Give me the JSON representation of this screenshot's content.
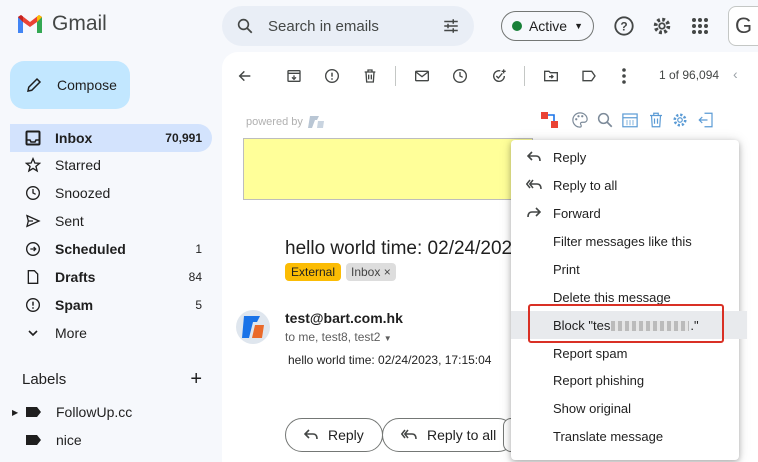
{
  "header": {
    "app_name": "Gmail",
    "search_placeholder": "Search in emails",
    "status_label": "Active",
    "account_initial": "G"
  },
  "sidebar": {
    "compose_label": "Compose",
    "items": [
      {
        "label": "Inbox",
        "count": "70,991",
        "icon": "inbox-icon"
      },
      {
        "label": "Starred",
        "count": "",
        "icon": "star-icon"
      },
      {
        "label": "Snoozed",
        "count": "",
        "icon": "clock-icon"
      },
      {
        "label": "Sent",
        "count": "",
        "icon": "send-icon"
      },
      {
        "label": "Scheduled",
        "count": "1",
        "icon": "scheduled-icon"
      },
      {
        "label": "Drafts",
        "count": "84",
        "icon": "draft-icon"
      },
      {
        "label": "Spam",
        "count": "5",
        "icon": "spam-icon"
      },
      {
        "label": "More",
        "count": "",
        "icon": "chevron-down-icon"
      }
    ],
    "labels_heading": "Labels",
    "labels": [
      {
        "label": "FollowUp.cc"
      },
      {
        "label": "nice"
      }
    ]
  },
  "toolbar": {
    "pager": "1 of 96,094"
  },
  "message": {
    "powered_by": "powered by",
    "subject": "hello world time: 02/24/2023, 17:15:04",
    "tag_external": "External",
    "tag_inbox": "Inbox",
    "sender": "test@bart.com.hk",
    "recipients": "to me, test8, test2",
    "body": "hello world time: 02/24/2023, 17:15:04",
    "reply_label": "Reply",
    "reply_all_label": "Reply to all"
  },
  "menu": {
    "items": [
      {
        "label": "Reply",
        "icon": "reply-icon"
      },
      {
        "label": "Reply to all",
        "icon": "reply-all-icon"
      },
      {
        "label": "Forward",
        "icon": "forward-icon"
      },
      {
        "label": "Filter messages like this",
        "icon": ""
      },
      {
        "label": "Print",
        "icon": ""
      },
      {
        "label": "Delete this message",
        "icon": ""
      },
      {
        "label": "Block \"tes",
        "label_end": ".\"",
        "icon": ""
      },
      {
        "label": "Report spam",
        "icon": ""
      },
      {
        "label": "Report phishing",
        "icon": ""
      },
      {
        "label": "Show original",
        "icon": ""
      },
      {
        "label": "Translate message",
        "icon": ""
      }
    ]
  },
  "colors": {
    "compose_bg": "#c2e7ff",
    "inbox_selected_bg": "#d3e3fd",
    "active_dot": "#188038",
    "external_tag": "#fbbc04",
    "highlight_box": "#d93025"
  }
}
